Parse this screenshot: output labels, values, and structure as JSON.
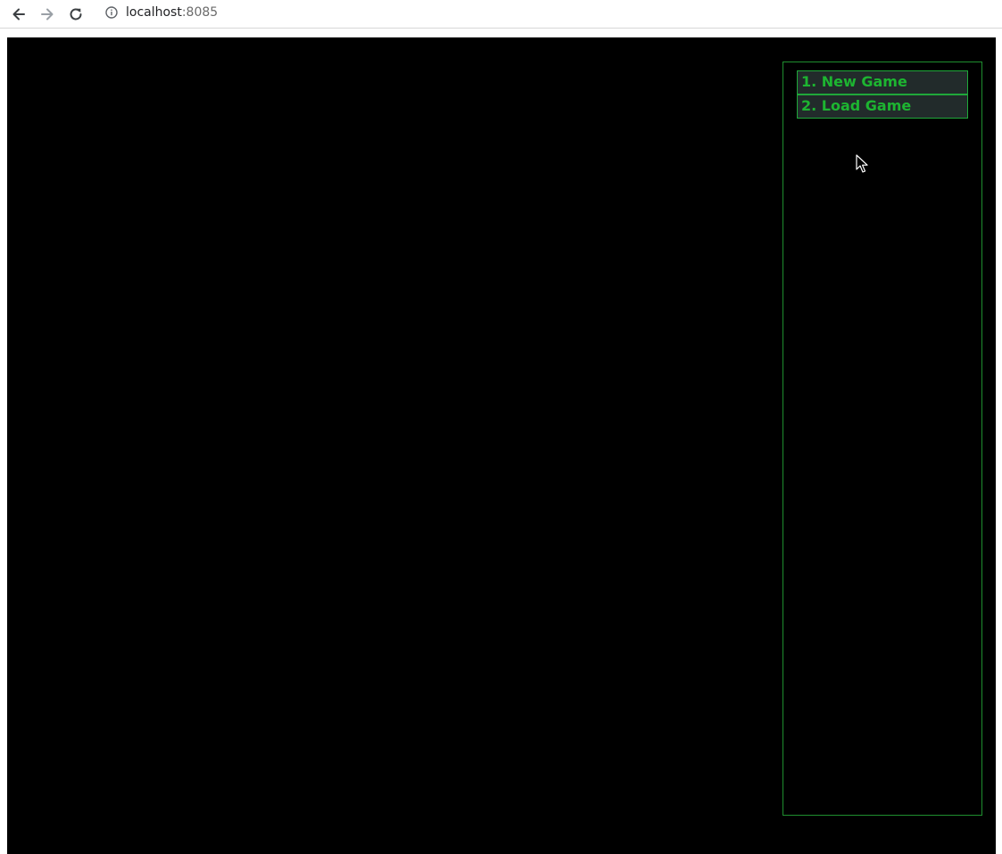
{
  "browser": {
    "url_host": "localhost",
    "url_port": ":8085",
    "icons": {
      "back": "arrow-left-icon",
      "forward": "arrow-right-icon",
      "reload": "reload-icon",
      "info": "info-icon"
    }
  },
  "game": {
    "menu": {
      "items": [
        {
          "label": "1. New Game"
        },
        {
          "label": "2. Load Game"
        }
      ]
    },
    "colors": {
      "background": "#000000",
      "accent_green": "#1db531",
      "panel_border": "#1f8f2f",
      "item_background": "#222b2b"
    }
  }
}
